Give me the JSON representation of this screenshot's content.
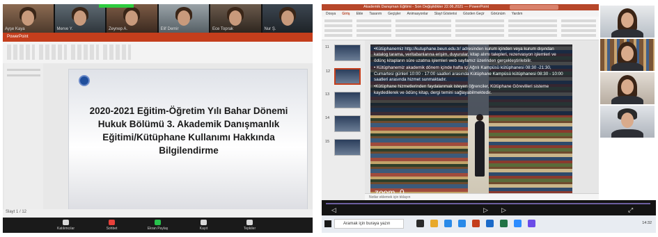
{
  "left_panel": {
    "gallery_names": [
      "Ayşe Kaya",
      "Merve Y.",
      "Zeynep A.",
      "Elif Demir",
      "Ece Toprak",
      "Nur Ş."
    ],
    "ppt_title_bar": "PowerPoint",
    "slide_title": "2020-2021 Eğitim-Öğretim Yılı Bahar Dönemi Hukuk Bölümü 3. Akademik Danışmanlık Eğitimi/Kütüphane Kullanımı Hakkında Bilgilendirme",
    "status_text": "Slayt 1 / 12",
    "zoom_controls": [
      "Katılımcılar",
      "Sohbet",
      "Ekran Paylaş",
      "Kayıt",
      "Tepkiler"
    ]
  },
  "right_panel": {
    "title_bar": "Akademik Danışman Eğitimi - Son Değişiklikler 22.06.2021 — PowerPoint",
    "menu": [
      "Dosya",
      "Giriş",
      "Ekle",
      "Tasarım",
      "Geçişler",
      "Animasyonlar",
      "Slayt Gösterisi",
      "Gözden Geçir",
      "Görünüm",
      "Yardım"
    ],
    "active_menu": "Giriş",
    "thumb_numbers": [
      "11",
      "12",
      "13",
      "14",
      "15"
    ],
    "slide_paragraphs": [
      "•Kütüphanemiz http://kutuphane.beun.edu.tr/ adresinden kurum içinden veya kurum dışından katalog tarama, veritabanlarına erişim, duyurular, kitap alımı talepleri, rezervasyon işlemleri ve ödünç kitapların süre uzatma işlemleri web sayfamız üzerinden gerçekleştirilebilir.",
      "• Kütüphanemiz akademik dönem içinde hafta içi Ağrılı Kampüsü kütüphanesi 08:30 -21:30, Cumartesi günleri 10:00 - 17:00 saatleri arasında Kütüphane Kampüsü kütüphanesi 08:30 - 10:00 saatleri arasında hizmet sunmaktadır.",
      "•Kütüphane hizmetlerinden faydalanmak isteyen öğrenciler, Kütüphane Görevlileri sisteme kaydedilerek ve ödünç kitap, dergi temini sağlayabilmektedir."
    ],
    "zoom_label": "zoom_0",
    "notes_placeholder": "Notlar eklemek için tıklayın",
    "taskbar_search": "Aramak için buraya yazın",
    "tray_time": "14:32"
  }
}
